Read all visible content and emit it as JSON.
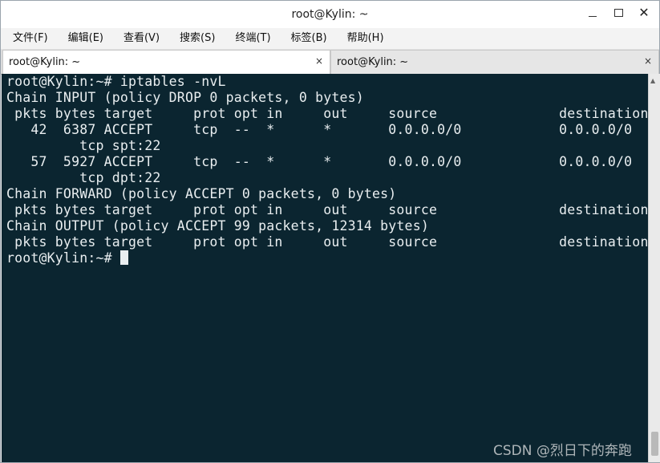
{
  "window": {
    "title": "root@Kylin: ~",
    "controls": {
      "minimize": "minimize-icon",
      "maximize": "maximize-icon",
      "close": "close-icon"
    }
  },
  "menubar": {
    "items": [
      "文件(F)",
      "编辑(E)",
      "查看(V)",
      "搜索(S)",
      "终端(T)",
      "标签(B)",
      "帮助(H)"
    ]
  },
  "tabs": [
    {
      "label": "root@Kylin: ~",
      "close": "×",
      "active": true
    },
    {
      "label": "root@Kylin: ~",
      "close": "×",
      "active": false
    }
  ],
  "terminal": {
    "lines": [
      "root@Kylin:~# iptables -nvL",
      "Chain INPUT (policy DROP 0 packets, 0 bytes)",
      " pkts bytes target     prot opt in     out     source               destination",
      "",
      "   42  6387 ACCEPT     tcp  --  *      *       0.0.0.0/0            0.0.0.0/0",
      "         tcp spt:22",
      "   57  5927 ACCEPT     tcp  --  *      *       0.0.0.0/0            0.0.0.0/0",
      "         tcp dpt:22",
      "",
      "Chain FORWARD (policy ACCEPT 0 packets, 0 bytes)",
      " pkts bytes target     prot opt in     out     source               destination",
      "",
      "",
      "Chain OUTPUT (policy ACCEPT 99 packets, 12314 bytes)",
      " pkts bytes target     prot opt in     out     source               destination",
      "",
      "root@Kylin:~# "
    ],
    "colors": {
      "background": "#0b2530",
      "foreground": "#e9eef0"
    }
  },
  "watermark": "CSDN @烈日下的奔跑"
}
